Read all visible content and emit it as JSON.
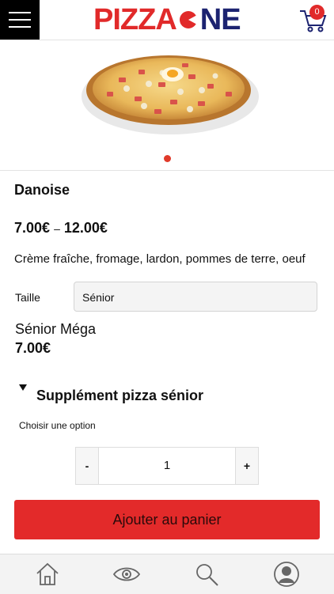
{
  "header": {
    "logo_text_1": "PIZZA",
    "logo_text_2": "NE",
    "cart_count": "0"
  },
  "product": {
    "name": "Danoise",
    "price_min": "7.00€",
    "price_sep": "–",
    "price_max": "12.00€",
    "description": "Crème fraîche, fromage, lardon, pommes de terre, oeuf",
    "size_label": "Taille",
    "size_selected": "Sénior",
    "variant_name": "Sénior Méga",
    "variant_price": "7.00€",
    "supplement_title": "Supplément pizza sénior",
    "choose_option": "Choisir une option",
    "qty_minus": "-",
    "qty_value": "1",
    "qty_plus": "+",
    "add_to_cart": "Ajouter au panier"
  },
  "colors": {
    "brand_red": "#e12a2a",
    "brand_navy": "#1c2370"
  },
  "tabbar": {
    "icons": [
      "home-icon",
      "eye-icon",
      "search-icon",
      "user-icon"
    ]
  }
}
